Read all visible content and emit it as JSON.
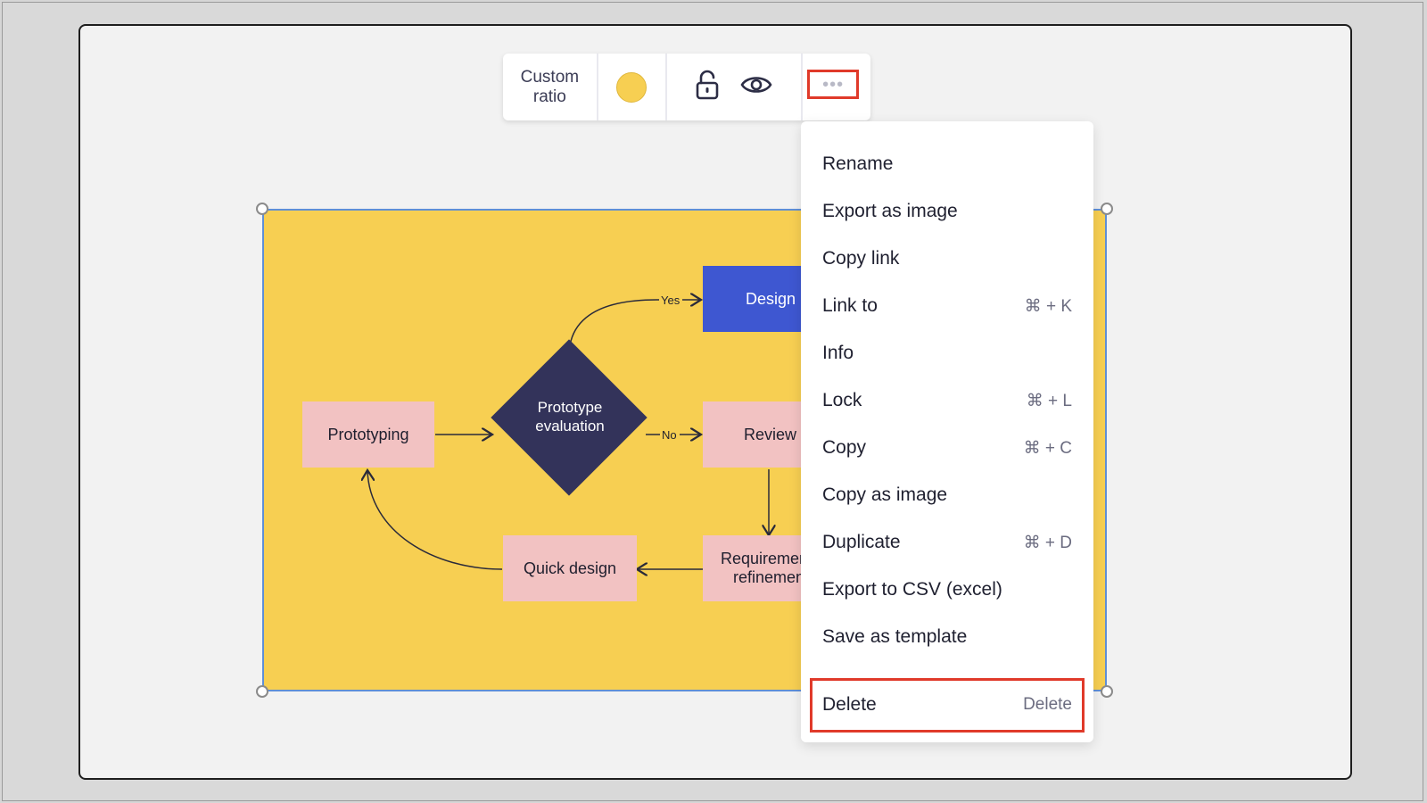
{
  "toolbar": {
    "ratio_line1": "Custom",
    "ratio_line2": "ratio",
    "color_icon": "yellow-color-swatch",
    "color_value": "#F7CF52",
    "lock_icon": "unlock-icon",
    "view_icon": "eye-icon",
    "more_icon": "more-dots-icon",
    "more_label": "•••"
  },
  "diagram": {
    "nodes": {
      "prototyping": "Prototyping",
      "evaluation_line1": "Prototype",
      "evaluation_line2": "evaluation",
      "design": "Design",
      "review": "Review",
      "quick_design": "Quick design",
      "requirement_line1": "Requirement",
      "requirement_line2": "refinement"
    },
    "edge_labels": {
      "yes": "Yes",
      "no": "No"
    }
  },
  "menu": {
    "items": [
      {
        "label": "Rename",
        "shortcut": ""
      },
      {
        "label": "Export as image",
        "shortcut": ""
      },
      {
        "label": "Copy link",
        "shortcut": ""
      },
      {
        "label": "Link to",
        "shortcut": "⌘ + K"
      },
      {
        "label": "Info",
        "shortcut": ""
      },
      {
        "label": "Lock",
        "shortcut": "⌘ + L"
      },
      {
        "label": "Copy",
        "shortcut": "⌘ + C"
      },
      {
        "label": "Copy as image",
        "shortcut": ""
      },
      {
        "label": "Duplicate",
        "shortcut": "⌘ + D"
      },
      {
        "label": "Export to CSV (excel)",
        "shortcut": ""
      },
      {
        "label": "Save as template",
        "shortcut": ""
      },
      {
        "label": "Delete",
        "shortcut": "Delete"
      }
    ]
  },
  "colors": {
    "board": "#F7CF52",
    "highlight": "#E03A2A",
    "selection": "#5F8FD6"
  }
}
